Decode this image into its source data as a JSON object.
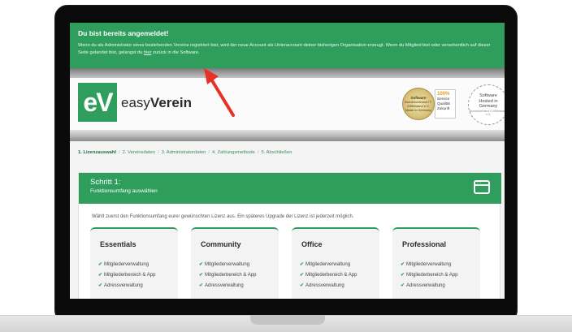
{
  "notice": {
    "title": "Du bist bereits angemeldet!",
    "text_before": "Wenn du als Administrator eines bestehenden Vereins registriert bist, wird der neue Account als Unteraccount deiner bisherigen Organisation erzeugt. Wenn du Mitglied bist oder versehentlich auf dieser Seite gelandet bist, gelangst du ",
    "link": "hier",
    "text_after": " zurück in die Software."
  },
  "brand": {
    "logo_mark": "eV",
    "name_light": "easy",
    "name_bold": "Verein"
  },
  "badges": {
    "seal_top": "Software",
    "seal_mid": "Bundesverband IT-Mittelstand e.V.",
    "seal_bottom": "Made in Germany",
    "pct": "100%",
    "lines": [
      "Service",
      "Qualität",
      "Zukunft"
    ],
    "hosted_lines": [
      "Software",
      "Hosted in",
      "Germany"
    ],
    "hosted_small": "Bundesverband IT-Mittelstand e.V."
  },
  "breadcrumb": [
    "1. Lizenzauswahl",
    "2. Vereinsdaten",
    "3. Administratordaten",
    "4. Zahlungsmethode",
    "5. Abschließen"
  ],
  "step": {
    "title": "Schritt 1:",
    "subtitle": "Funktionsumfang auswählen",
    "description": "Wählt zuerst den Funktionsumfang eurer gewünschten Lizenz aus. Ein späteres Upgrade der Lizenz ist jederzeit möglich."
  },
  "plans": [
    {
      "name": "Essentials",
      "features": [
        "Mitgliederverwaltung",
        "Mitgliederbereich & App",
        "Adressverwaltung"
      ]
    },
    {
      "name": "Community",
      "features": [
        "Mitgliederverwaltung",
        "Mitgliederbereich & App",
        "Adressverwaltung"
      ]
    },
    {
      "name": "Office",
      "features": [
        "Mitgliederverwaltung",
        "Mitgliederbereich & App",
        "Adressverwaltung"
      ]
    },
    {
      "name": "Professional",
      "features": [
        "Mitgliederverwaltung",
        "Mitgliederbereich & App",
        "Adressverwaltung"
      ]
    }
  ],
  "colors": {
    "accent": "#2f9e5c",
    "annotation_arrow": "#e53224"
  },
  "icons": {
    "check": "check-icon",
    "window": "browser-window-icon",
    "arrow": "red-annotation-arrow"
  }
}
